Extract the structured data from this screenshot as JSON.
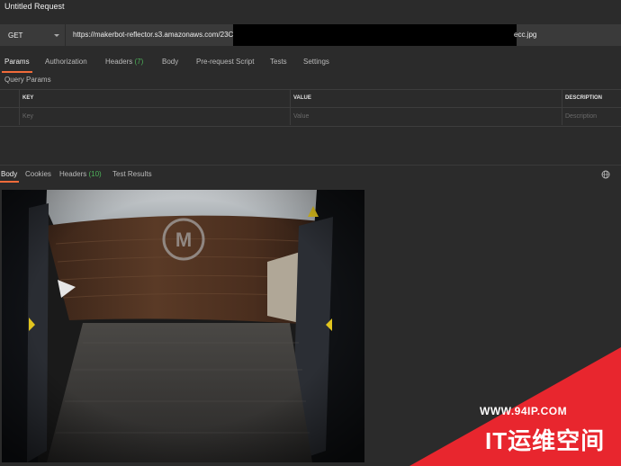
{
  "window": {
    "title": "Untitled Request"
  },
  "request": {
    "method": "GET",
    "url_visible_start": "https://makerbot-reflector.s3.amazonaws.com/23C",
    "url_visible_end": "ecc.jpg"
  },
  "request_tabs": [
    {
      "label": "Params",
      "count": ""
    },
    {
      "label": "Authorization",
      "count": ""
    },
    {
      "label": "Headers",
      "count": "(7)"
    },
    {
      "label": "Body",
      "count": ""
    },
    {
      "label": "Pre-request Script",
      "count": ""
    },
    {
      "label": "Tests",
      "count": ""
    },
    {
      "label": "Settings",
      "count": ""
    }
  ],
  "params": {
    "section_title": "Query Params",
    "columns": [
      "KEY",
      "VALUE",
      "DESCRIPTION"
    ],
    "placeholders": {
      "key": "Key",
      "value": "Value",
      "description": "Description"
    }
  },
  "response_tabs": [
    {
      "label": "Body",
      "count": ""
    },
    {
      "label": "Cookies",
      "count": ""
    },
    {
      "label": "Headers",
      "count": "(10)"
    },
    {
      "label": "Test Results",
      "count": ""
    }
  ],
  "watermark": {
    "url": "WWW.94IP.COM",
    "text": "IT运维空间"
  },
  "colors": {
    "accent": "#f26b3a",
    "count_green": "#4db35a",
    "watermark_red": "#e8262e"
  }
}
